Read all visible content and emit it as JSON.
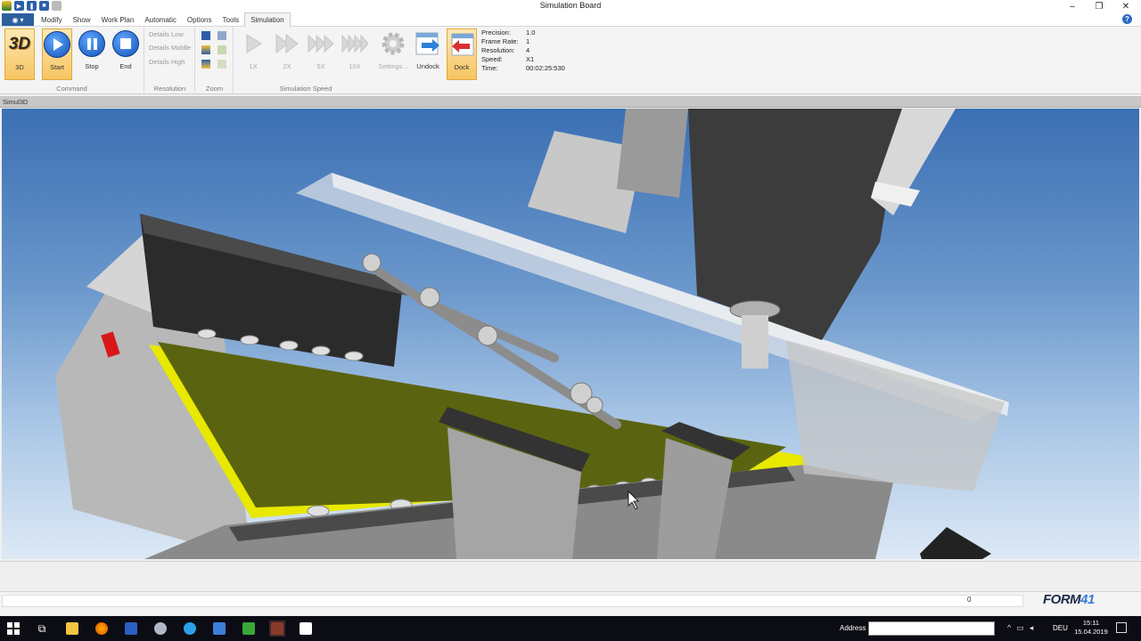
{
  "window": {
    "title": "Simulation Board"
  },
  "menu": {
    "tabs": [
      {
        "label": "Modify"
      },
      {
        "label": "Show"
      },
      {
        "label": "Work Plan"
      },
      {
        "label": "Automatic"
      },
      {
        "label": "Options"
      },
      {
        "label": "Tools"
      },
      {
        "label": "Simulation"
      }
    ],
    "active_tab": "Simulation"
  },
  "ribbon": {
    "command": {
      "group_label": "Command",
      "btn_3d": "3D",
      "btn_3d_icon_text": "3D",
      "btn_start": "Start",
      "btn_stop": "Stop",
      "btn_end": "End"
    },
    "resolution": {
      "group_label": "Resolution",
      "low": "Details Low",
      "middle": "Details Middle",
      "high": "Details High"
    },
    "zoom": {
      "group_label": "Zoom"
    },
    "speed": {
      "group_label": "Simulation Speed",
      "s1": "1X",
      "s2": "2X",
      "s5": "5X",
      "s10": "10X",
      "settings": "Settings...",
      "undock": "Undock",
      "dock": "Dock"
    },
    "info": {
      "precision_label": "Precision:",
      "precision": "1.0",
      "frame_rate_label": "Frame Rate:",
      "frame_rate": "1",
      "resolution_label": "Resolution:",
      "resolution": "4",
      "speed_label": "Speed:",
      "speed": "X1",
      "time_label": "Time:",
      "time": "00:02:25:530"
    }
  },
  "viewport": {
    "header": "Simul3D"
  },
  "statusbar": {
    "value": "0"
  },
  "logo": {
    "main": "FORM",
    "sub": "41"
  },
  "taskbar": {
    "address_label": "Address",
    "lang": "DEU",
    "time": "15:11",
    "date": "15.04.2019"
  },
  "colors": {
    "accent_blue": "#1451b8",
    "board_green": "#5a6410",
    "board_edge": "#e8e800",
    "highlight": "#f7c462"
  }
}
